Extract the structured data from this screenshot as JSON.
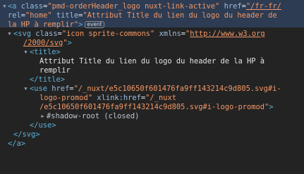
{
  "a": {
    "open": "<a",
    "class_name": "class",
    "class_value": "\"pmd-orderHeader_logo nuxt-link-active\"",
    "href_name": "href",
    "href_value": "\"/fr-fr/",
    "href_close": "\"",
    "rel_name": "rel",
    "rel_value": "\"home\"",
    "title_name": "title",
    "title_value_1": "\"Attribut Title du lien du logo du header de",
    "title_value_2": "la HP à remplir\"",
    "close_bracket": ">",
    "badge": "event",
    "end_tag": "</a>"
  },
  "svg": {
    "open": "<svg",
    "class_name": "class",
    "class_value": "\"icon sprite-commons\"",
    "xmlns_name": "xmlns",
    "xmlns_value_quote_open": "\"",
    "xmlns_url_1": "http://www.w3.org",
    "xmlns_url_2": "/2000/svg",
    "xmlns_value_quote_close": "\"",
    "close_bracket": ">",
    "end_tag": "</svg>"
  },
  "title_el": {
    "open_tag": "<title>",
    "text_1": "Attribut Title du lien du logo du header de la HP à",
    "text_2": "remplir",
    "end_tag": "</title>"
  },
  "use_el": {
    "open": "<use",
    "href_name": "href",
    "href_value_1": "\"/_nuxt/e5c10650f601476fa9ff143214c9d805.svg#i-",
    "href_value_2": "logo-promod\"",
    "xlink_name": "xlink:href",
    "xlink_value_1": "\"/_nuxt",
    "xlink_value_2": "/e5c10650f601476fa9ff143214c9d805.svg#i-logo-promod\"",
    "close_bracket": ">",
    "shadow_root": "#shadow-root (closed)",
    "end_tag": "</use>"
  },
  "colors": {
    "background": "#232323",
    "selection": "#2d3c53",
    "tag": "#5db0d7",
    "attr_name": "#9bbbdc",
    "attr_value": "#f29766",
    "text": "#e4e4e4"
  },
  "icons": {
    "expanded": "triangle-down-icon",
    "collapsed": "triangle-right-icon"
  }
}
